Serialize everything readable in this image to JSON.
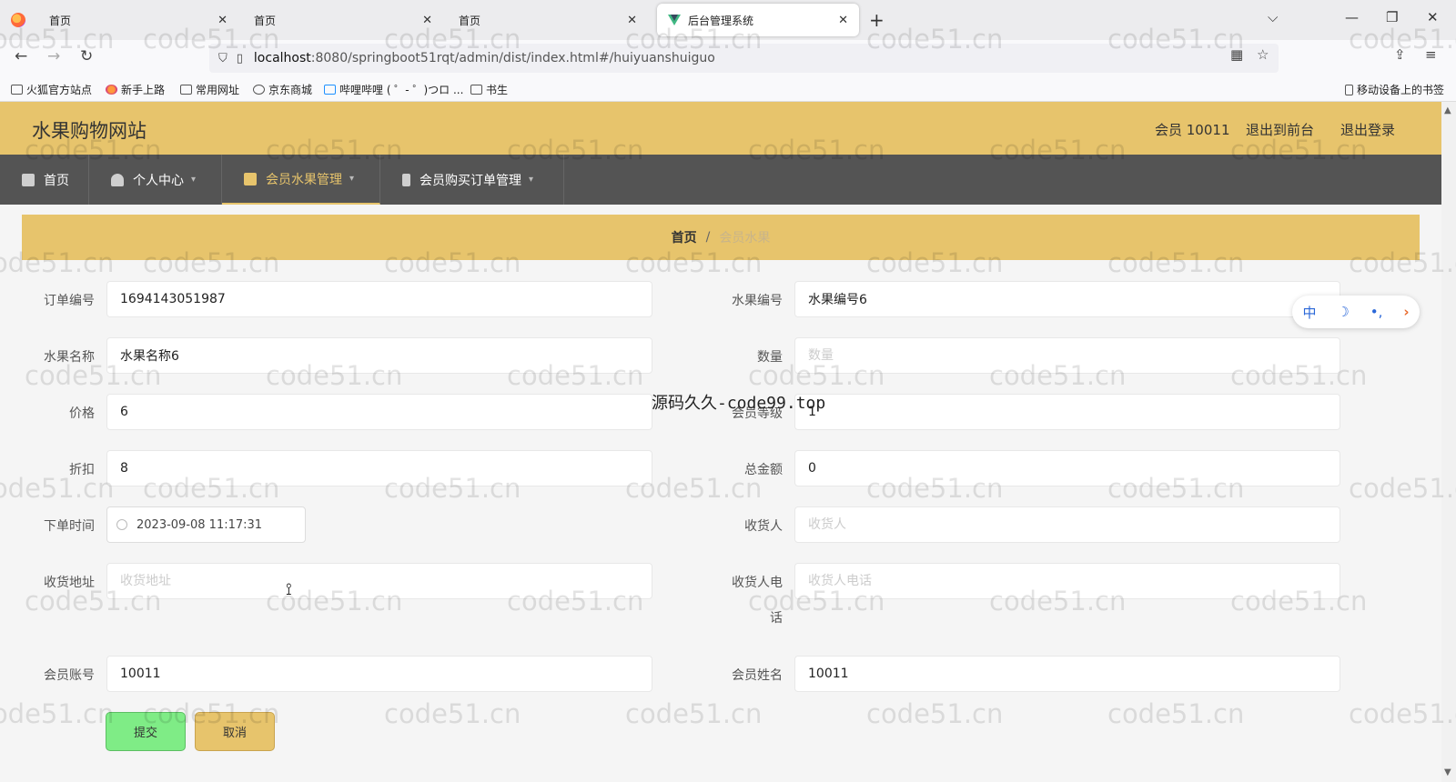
{
  "browser": {
    "tabs": [
      {
        "label": "首页",
        "active": false
      },
      {
        "label": "首页",
        "active": false
      },
      {
        "label": "首页",
        "active": false
      },
      {
        "label": "后台管理系统",
        "active": true
      }
    ],
    "url_host": "localhost",
    "url_path": ":8080/springboot51rqt/admin/dist/index.html#/huiyuanshuiguo",
    "bookmarks": [
      "火狐官方站点",
      "新手上路",
      "常用网址",
      "京东商城",
      "哔哩哔哩 ( ゜- ゜)つロ ...",
      "书生"
    ],
    "mobile_bookmarks": "移动设备上的书签"
  },
  "header": {
    "site_title": "水果购物网站",
    "user": "会员 10011",
    "back_front": "退出到前台",
    "logout": "退出登录"
  },
  "menu": {
    "items": [
      {
        "label": "首页",
        "icon": "home-icon",
        "has_caret": false
      },
      {
        "label": "个人中心",
        "icon": "user-icon",
        "has_caret": true
      },
      {
        "label": "会员水果管理",
        "icon": "briefcase-icon",
        "has_caret": true,
        "active": true
      },
      {
        "label": "会员购买订单管理",
        "icon": "phone-icon",
        "has_caret": true
      }
    ]
  },
  "breadcrumb": {
    "home": "首页",
    "sep": "/",
    "current": "会员水果"
  },
  "form": {
    "order_no": {
      "label": "订单编号",
      "value": "1694143051987"
    },
    "fruit_no": {
      "label": "水果编号",
      "value": "水果编号6"
    },
    "fruit_name": {
      "label": "水果名称",
      "value": "水果名称6"
    },
    "quantity": {
      "label": "数量",
      "value": "",
      "placeholder": "数量"
    },
    "price": {
      "label": "价格",
      "value": "6"
    },
    "member_level": {
      "label": "会员等级",
      "value": "1"
    },
    "discount": {
      "label": "折扣",
      "value": "8"
    },
    "total": {
      "label": "总金额",
      "value": "0"
    },
    "order_time": {
      "label": "下单时间",
      "value": "2023-09-08 11:17:31"
    },
    "receiver": {
      "label": "收货人",
      "value": "",
      "placeholder": "收货人"
    },
    "address": {
      "label": "收货地址",
      "value": "",
      "placeholder": "收货地址"
    },
    "receiver_phone": {
      "label_line1": "收货人电",
      "label_line2": "话",
      "value": "",
      "placeholder": "收货人电话"
    },
    "member_account": {
      "label": "会员账号",
      "value": "10011"
    },
    "member_name": {
      "label": "会员姓名",
      "value": "10011"
    },
    "submit": "提交",
    "cancel": "取消"
  },
  "float_tools": {
    "lang": "中",
    "moon": "☽",
    "dots": "•,",
    "arrow": "›"
  },
  "watermark_text": "code51.cn",
  "center_watermark": "源码久久-code99.top",
  "colors": {
    "accent": "#e7c46c",
    "menu_bg": "#545454",
    "submit": "#7fec86"
  }
}
